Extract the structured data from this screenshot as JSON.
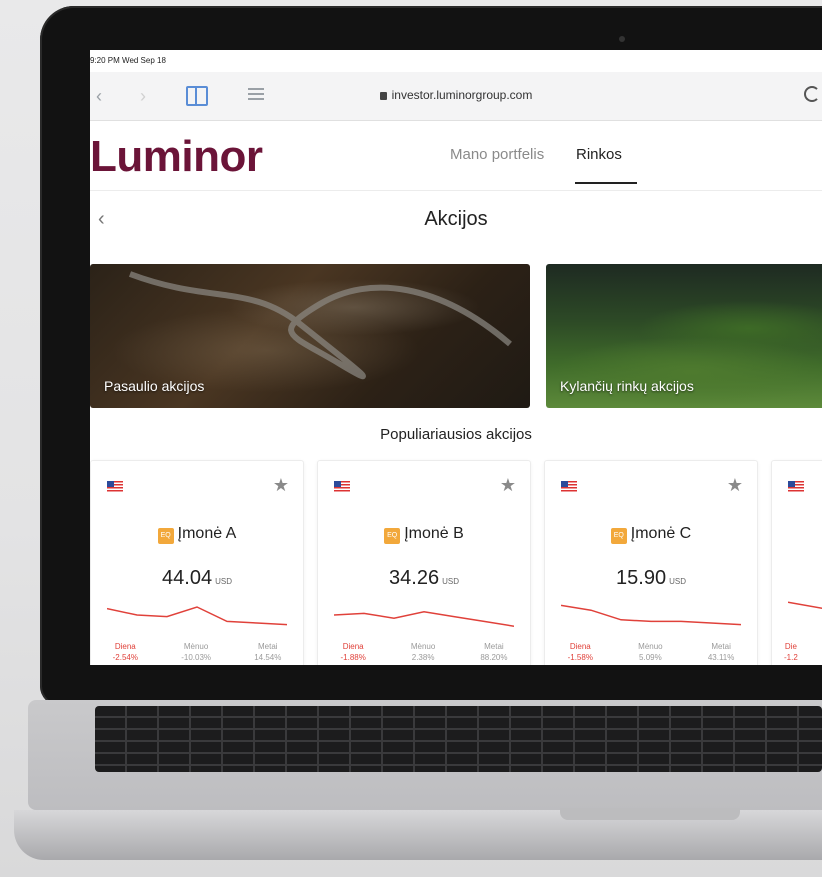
{
  "statusbar": {
    "time": "9:20 PM",
    "date": "Wed Sep 18"
  },
  "browser": {
    "url": "investor.luminorgroup.com"
  },
  "header": {
    "logo": "Luminor",
    "tabs": [
      {
        "label": "Mano portfelis",
        "active": false
      },
      {
        "label": "Rinkos",
        "active": true
      }
    ]
  },
  "page": {
    "title": "Akcijos"
  },
  "tiles": [
    {
      "label": "Pasaulio akcijos"
    },
    {
      "label": "Kylančių rinkų akcijos"
    }
  ],
  "section": {
    "title": "Populiariausios akcijos"
  },
  "cards": [
    {
      "company": "Įmonė A",
      "badge": "EQ",
      "price": "44.04",
      "currency": "USD",
      "spark": [
        0.3,
        0.5,
        0.55,
        0.25,
        0.7,
        0.75,
        0.8
      ],
      "stats": [
        {
          "label": "Diena",
          "value": "-2.54%"
        },
        {
          "label": "Mėnuo",
          "value": "-10.03%"
        },
        {
          "label": "Metai",
          "value": "14.54%"
        }
      ]
    },
    {
      "company": "Įmonė B",
      "badge": "EQ",
      "price": "34.26",
      "currency": "USD",
      "spark": [
        0.5,
        0.45,
        0.6,
        0.4,
        0.55,
        0.7,
        0.85
      ],
      "stats": [
        {
          "label": "Diena",
          "value": "-1.88%"
        },
        {
          "label": "Mėnuo",
          "value": "2.38%"
        },
        {
          "label": "Metai",
          "value": "88.20%"
        }
      ]
    },
    {
      "company": "Įmonė C",
      "badge": "EQ",
      "price": "15.90",
      "currency": "USD",
      "spark": [
        0.2,
        0.35,
        0.65,
        0.7,
        0.7,
        0.75,
        0.8
      ],
      "stats": [
        {
          "label": "Diena",
          "value": "-1.58%"
        },
        {
          "label": "Mėnuo",
          "value": "5.09%"
        },
        {
          "label": "Metai",
          "value": "43.11%"
        }
      ]
    },
    {
      "company": "",
      "badge": "",
      "price": "",
      "currency": "",
      "spark": [
        0.1,
        0.6,
        0.9
      ],
      "stats": [
        {
          "label": "Die",
          "value": "-1.2"
        }
      ]
    }
  ],
  "colors": {
    "brand": "#6b1438",
    "negative": "#e0413a",
    "badge": "#f2a83b"
  }
}
